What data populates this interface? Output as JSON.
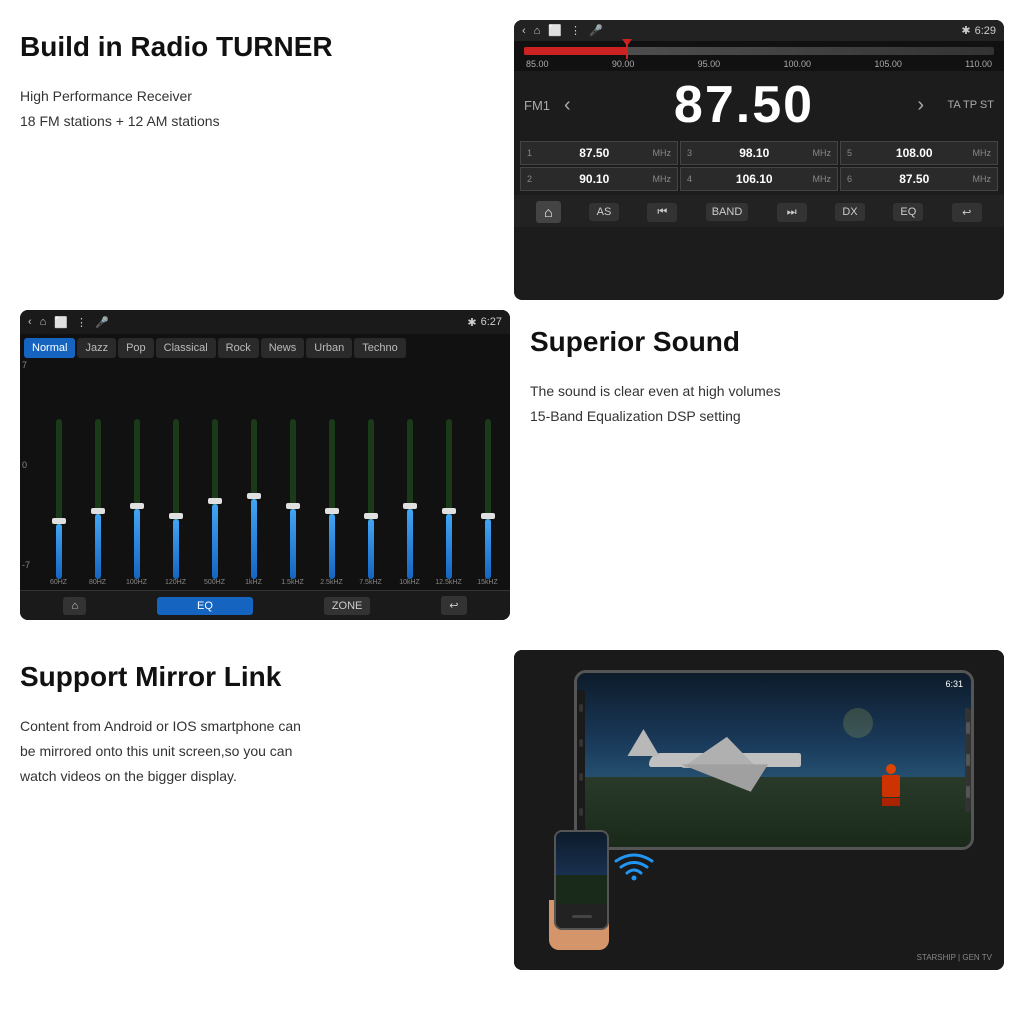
{
  "sections": {
    "radio": {
      "title": "Build in Radio TURNER",
      "desc_line1": "High Performance Receiver",
      "desc_line2": "18 FM stations + 12 AM stations",
      "screen": {
        "time": "6:29",
        "band": "FM1",
        "frequency": "87.50",
        "tuner_labels": [
          "85.00",
          "90.00",
          "95.00",
          "100.00",
          "105.00",
          "110.00"
        ],
        "rds_text": "TA TP ST",
        "presets": [
          {
            "num": "1",
            "freq": "87.50",
            "unit": "MHz"
          },
          {
            "num": "3",
            "freq": "98.10",
            "unit": "MHz"
          },
          {
            "num": "5",
            "freq": "108.00",
            "unit": "MHz"
          },
          {
            "num": "2",
            "freq": "90.10",
            "unit": "MHz"
          },
          {
            "num": "4",
            "freq": "106.10",
            "unit": "MHz"
          },
          {
            "num": "6",
            "freq": "87.50",
            "unit": "MHz"
          }
        ],
        "controls": [
          "AS",
          "⏮",
          "BAND",
          "⏭",
          "DX",
          "EQ"
        ]
      }
    },
    "equalizer": {
      "title": "Superior Sound",
      "desc_line1": "The sound is clear even at high volumes",
      "desc_line2": "15-Band Equalization DSP setting",
      "screen": {
        "time": "6:27",
        "modes": [
          "Normal",
          "Jazz",
          "Pop",
          "Classical",
          "Rock",
          "News",
          "Urban",
          "Techno"
        ],
        "active_mode": "Normal",
        "y_labels": [
          "7",
          "0",
          "-7"
        ],
        "x_labels": [
          "60HZ",
          "80HZ",
          "100HZ",
          "120HZ",
          "500HZ",
          "1kHZ",
          "1.5kHZ",
          "2.5kHZ",
          "7.5kHZ",
          "10kHZ",
          "12.5kHZ",
          "15kHZ"
        ],
        "slider_heights": [
          55,
          65,
          70,
          60,
          75,
          80,
          70,
          65,
          60,
          70,
          65,
          60
        ],
        "slider_thumbs": [
          55,
          65,
          70,
          60,
          75,
          80,
          70,
          65,
          60,
          70,
          65,
          60
        ],
        "bottom_btns": [
          "🏠",
          "EQ",
          "ZONE",
          "↩"
        ]
      }
    },
    "mirror_link": {
      "title": "Support Mirror Link",
      "desc_line1": "Content from Android or IOS smartphone can",
      "desc_line2": "be mirrored onto this unit screen,so you can",
      "desc_line3": "watch videos on the  bigger display.",
      "screen": {
        "time": "6:31"
      }
    }
  }
}
